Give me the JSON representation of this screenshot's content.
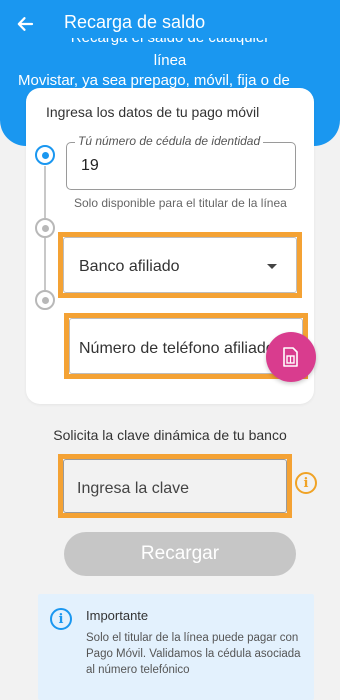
{
  "header": {
    "title": "Recarga de saldo",
    "description_clipped": "Recarga el saldo de cualquier",
    "description_line1": "línea",
    "description_line2": "Movistar, ya sea prepago, móvil, fija o de"
  },
  "card": {
    "title": "Ingresa los datos de tu pago móvil",
    "cedula": {
      "label": "Tú número de cédula de identidad",
      "value": "19",
      "helper": "Solo disponible para el titular de la línea"
    },
    "banco": {
      "placeholder": "Banco afiliado"
    },
    "telefono": {
      "placeholder": "Número de teléfono afiliado"
    }
  },
  "clave": {
    "title": "Solicita la clave dinámica de tu banco",
    "placeholder": "Ingresa la clave"
  },
  "submit_label": "Recargar",
  "importante": {
    "title": "Importante",
    "text": "Solo el titular de la línea puede pagar con Pago Móvil. Validamos la cédula asociada al número telefónico"
  },
  "colors": {
    "primary": "#1a97f0",
    "highlight": "#f4a234",
    "fab": "#d93c8e",
    "disabled_button": "#c6c6c6",
    "info_bg": "#e3f1fd"
  },
  "icons": {
    "back": "arrow-left-icon",
    "dropdown": "caret-down-icon",
    "fab": "sim-card-icon",
    "info": "info-icon"
  }
}
